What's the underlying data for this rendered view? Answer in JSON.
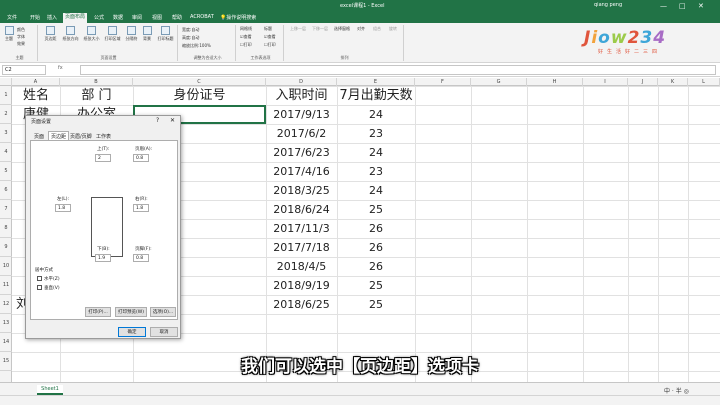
{
  "titlebar": {
    "title": "excel课程1 - Excel",
    "user": "qiang peng",
    "minimize": "—",
    "maximize": "□",
    "close": "✕"
  },
  "tabs": [
    "文件",
    "开始",
    "插入",
    "页面布局",
    "公式",
    "数据",
    "审阅",
    "视图",
    "帮助",
    "ACROBAT",
    "操作说明搜索"
  ],
  "ribbon": {
    "theme_label": "主题",
    "colors_label": "颜色",
    "fonts_label": "字体",
    "effects_label": "效果",
    "margins_label": "页边距",
    "orientation_label": "纸张方向",
    "size_label": "纸张大小",
    "print_area_label": "打印区域",
    "breaks_label": "分隔符",
    "background_label": "背景",
    "print_titles_label": "打印标题",
    "width_label": "宽度:",
    "width_value": "自动",
    "height_label": "高度:",
    "height_value": "自动",
    "scale_label": "缩放比例:",
    "scale_value": "100%",
    "gridlines_label": "网格线",
    "headings_label": "标题",
    "view_label": "查看",
    "print_label": "打印",
    "bring_forward": "上移一层",
    "send_backward": "下移一层",
    "selection_pane": "选择窗格",
    "align": "对齐",
    "group": "组合",
    "rotate": "旋转",
    "group_theme": "主题",
    "group_page_setup": "页面设置",
    "group_scale": "调整为合适大小",
    "group_sheet_options": "工作表选项",
    "group_arrange": "排列"
  },
  "logo": {
    "text": "Jiow234",
    "slogan": "好生活好二三四"
  },
  "formula_bar": {
    "name_box": "C2",
    "fx": "fx"
  },
  "columns": [
    "A",
    "B",
    "C",
    "D",
    "E",
    "F",
    "G",
    "H",
    "I",
    "J",
    "K",
    "L"
  ],
  "rows": [
    "1",
    "2",
    "3",
    "4",
    "5",
    "6",
    "7",
    "8",
    "9",
    "10",
    "11",
    "12",
    "13",
    "14",
    "15"
  ],
  "sheet": {
    "headers": [
      "姓名",
      "部 门",
      "身份证号",
      "入职时间",
      "7月出勤天数"
    ],
    "col_a": [
      "唐健",
      "",
      "",
      "",
      "",
      "",
      "",
      "",
      "",
      "",
      "刘"
    ],
    "col_b": [
      "办公室"
    ],
    "dates": [
      "2017/9/13",
      "2017/6/2",
      "2017/6/23",
      "2017/4/16",
      "2018/3/25",
      "2018/6/24",
      "2017/11/3",
      "2017/7/18",
      "2018/4/5",
      "2018/9/19",
      "2018/6/25"
    ],
    "days": [
      "24",
      "23",
      "24",
      "23",
      "24",
      "25",
      "26",
      "26",
      "26",
      "25",
      "25"
    ]
  },
  "dialog": {
    "title": "页面设置",
    "help": "?",
    "close": "✕",
    "tabs": [
      "页面",
      "页边距",
      "页眉/页脚",
      "工作表"
    ],
    "top_label": "上(T):",
    "top_value": "2",
    "header_label": "页眉(A):",
    "header_value": "0.8",
    "left_label": "左(L):",
    "left_value": "1.8",
    "right_label": "右(R):",
    "right_value": "1.8",
    "bottom_label": "下(B):",
    "bottom_value": "1.9",
    "footer_label": "页脚(F):",
    "footer_value": "0.8",
    "center_label": "居中方式",
    "horizontal_label": "水平(Z)",
    "vertical_label": "垂直(V)",
    "print_btn": "打印(P)...",
    "preview_btn": "打印预览(W)",
    "options_btn": "选项(O)...",
    "ok_btn": "确定",
    "cancel_btn": "取消"
  },
  "sheet_tab": "Sheet1",
  "ime": "中 · 半 ◎",
  "subtitle": "我们可以选中【页边距】选项卡"
}
